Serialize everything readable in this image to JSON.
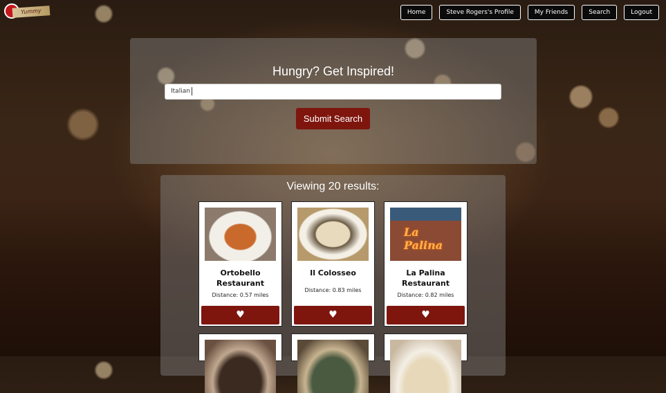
{
  "logo": {
    "text": "Yummy"
  },
  "nav": {
    "home": "Home",
    "profile": "Steve Rogers's Profile",
    "friends": "My Friends",
    "search": "Search",
    "logout": "Logout"
  },
  "search": {
    "title": "Hungry? Get Inspired!",
    "value": "Italian",
    "submit_label": "Submit Search"
  },
  "results": {
    "title": "Viewing 20 results:",
    "items": [
      {
        "name": "Ortobello Restaurant",
        "distance": "Distance: 0.57 miles"
      },
      {
        "name": "Il Colosseo",
        "distance": "Distance: 0.83 miles"
      },
      {
        "name": "La Palina Restaurant",
        "distance": "Distance: 0.82 miles"
      }
    ],
    "photo_sign": "La Palina",
    "favorite_icon": "heart-icon"
  }
}
